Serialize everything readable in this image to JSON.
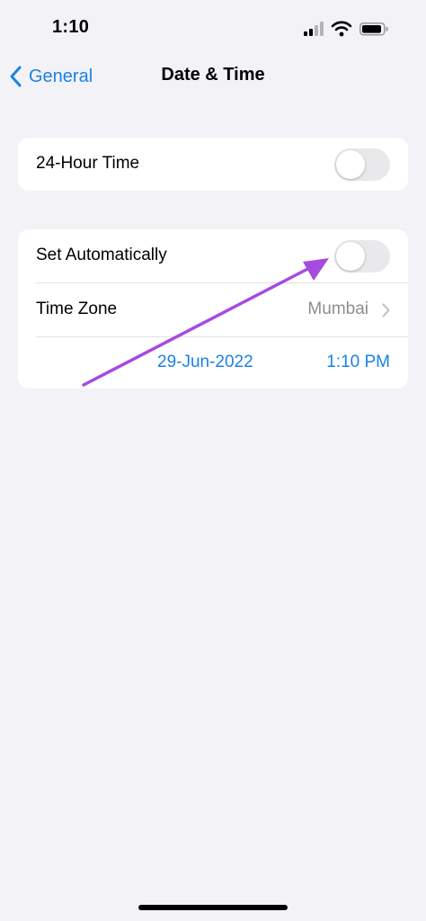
{
  "status_bar": {
    "time": "1:10"
  },
  "nav": {
    "back_label": "General",
    "title": "Date & Time"
  },
  "settings": {
    "hour24": {
      "label": "24-Hour Time",
      "enabled": false
    },
    "set_automatically": {
      "label": "Set Automatically",
      "enabled": false
    },
    "time_zone": {
      "label": "Time Zone",
      "value": "Mumbai"
    },
    "date": "29-Jun-2022",
    "time": "1:10 PM"
  },
  "colors": {
    "accent": "#1a82e6",
    "background": "#f2f2f7",
    "toggle_off": "#e9e9eb",
    "annotation_arrow": "#a64ae0"
  }
}
